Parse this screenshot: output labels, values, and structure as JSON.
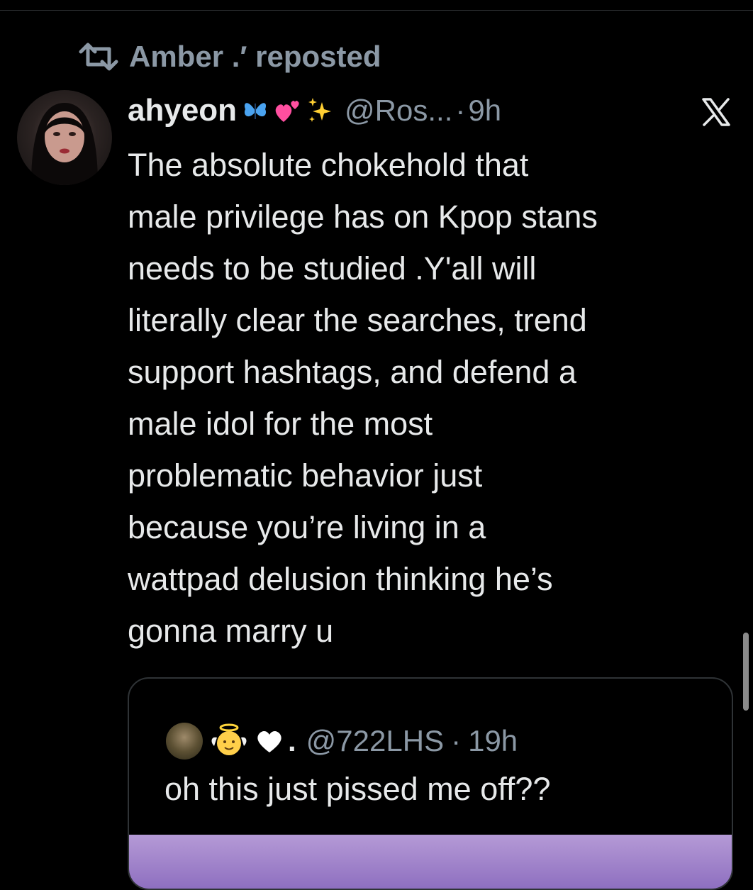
{
  "repost": {
    "label": "Amber .′ reposted"
  },
  "post": {
    "display_name": "ahyeon",
    "badges": [
      "butterfly-emoji",
      "two-hearts-emoji",
      "sparkles-emoji"
    ],
    "handle": "@Ros...",
    "time": "9h",
    "body_lines": [
      "The absolute chokehold that",
      "male privilege has on Kpop stans",
      "needs to be studied .Y'all will",
      "literally clear the searches, trend",
      "support hashtags, and defend a",
      "male idol for the most",
      "problematic behavior just",
      "because you’re living in a",
      "wattpad delusion thinking he’s",
      "gonna marry u"
    ]
  },
  "quote": {
    "name_emojis": [
      "baby-angel-emoji",
      "white-heart-emoji"
    ],
    "name_dot": ".",
    "handle": "@722LHS",
    "time": "19h",
    "text": "oh this just pissed me off??"
  },
  "colors": {
    "background": "#000000",
    "text": "#e7e9ea",
    "muted": "#8b98a5",
    "border": "#2f3336",
    "media": "#a385cc"
  }
}
